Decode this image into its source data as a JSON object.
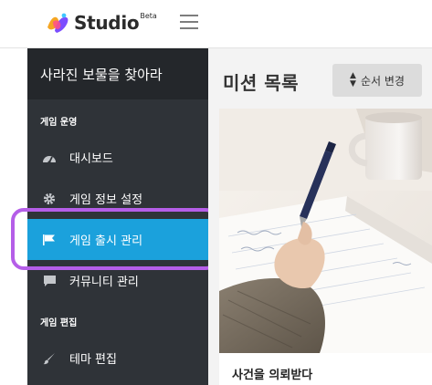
{
  "app": {
    "logo_text": "Studio",
    "logo_badge": "Beta"
  },
  "colors": {
    "sidebar_bg": "#2f3338",
    "sidebar_title_bg": "#24272b",
    "active_item": "#1ba1dc",
    "highlight_outline": "#b55ee8"
  },
  "sidebar": {
    "project_title": "사라진 보물을 찾아라",
    "sections": [
      {
        "label": "게임 운영",
        "items": [
          {
            "label": "대시보드",
            "icon": "dashboard-icon"
          },
          {
            "label": "게임 정보 설정",
            "icon": "gear-icon"
          },
          {
            "label": "게임 출시 관리",
            "icon": "flag-icon",
            "active": true
          },
          {
            "label": "커뮤니티 관리",
            "icon": "chat-icon"
          }
        ]
      },
      {
        "label": "게임 편집",
        "items": [
          {
            "label": "테마 편집",
            "icon": "brush-icon"
          }
        ]
      }
    ]
  },
  "main": {
    "title": "미션 목록",
    "order_button": "순서 변경",
    "cards": [
      {
        "title": "사건을 의뢰받다",
        "image": "writing-photo"
      }
    ]
  }
}
